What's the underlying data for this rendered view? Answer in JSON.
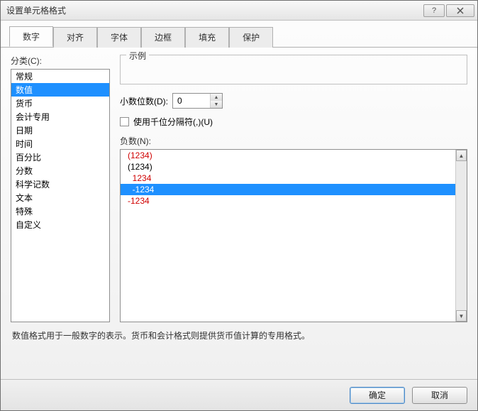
{
  "title": "设置单元格格式",
  "tabs": [
    {
      "label": "数字"
    },
    {
      "label": "对齐"
    },
    {
      "label": "字体"
    },
    {
      "label": "边框"
    },
    {
      "label": "填充"
    },
    {
      "label": "保护"
    }
  ],
  "category_label": "分类(C):",
  "categories": [
    "常规",
    "数值",
    "货币",
    "会计专用",
    "日期",
    "时间",
    "百分比",
    "分数",
    "科学记数",
    "文本",
    "特殊",
    "自定义"
  ],
  "selected_category_index": 1,
  "sample_label": "示例",
  "decimal_label": "小数位数(D):",
  "decimal_value": "0",
  "thousand_sep_label": "使用千位分隔符(,)(U)",
  "thousand_sep_checked": false,
  "neg_label": "负数(N):",
  "neg_items": [
    {
      "text": "(1234)",
      "color": "red"
    },
    {
      "text": "(1234)",
      "color": "black"
    },
    {
      "text": "  1234",
      "color": "red"
    },
    {
      "text": "  -1234",
      "color": "black"
    },
    {
      "text": "-1234",
      "color": "red"
    }
  ],
  "selected_neg_index": 3,
  "description": "数值格式用于一般数字的表示。货币和会计格式则提供货币值计算的专用格式。",
  "buttons": {
    "ok": "确定",
    "cancel": "取消"
  }
}
